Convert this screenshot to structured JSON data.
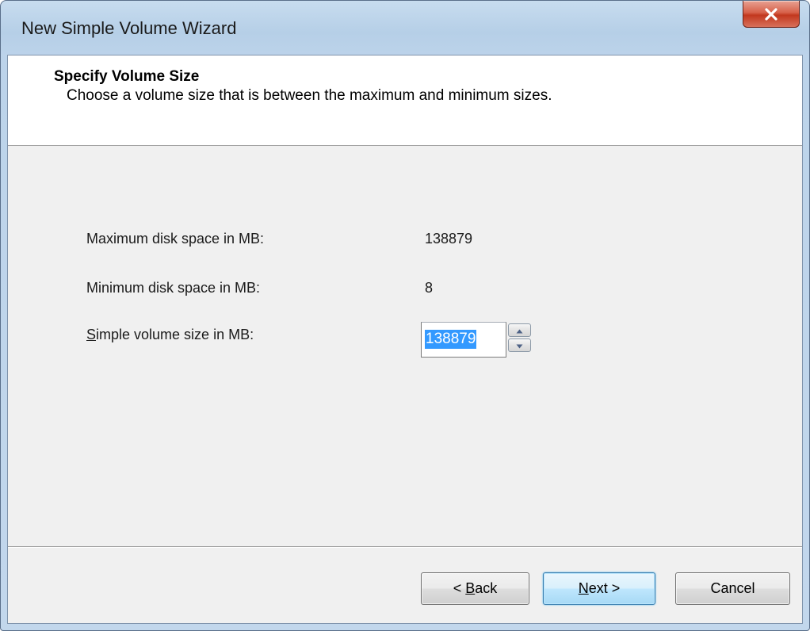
{
  "window": {
    "title": "New Simple Volume Wizard",
    "close_icon": "close-icon"
  },
  "header": {
    "title": "Specify Volume Size",
    "subtitle": "Choose a volume size that is between the maximum and minimum sizes."
  },
  "fields": {
    "max": {
      "label": "Maximum disk space in MB:",
      "value": "138879"
    },
    "min": {
      "label": "Minimum disk space in MB:",
      "value": "8"
    },
    "size": {
      "label_mnemonic": "S",
      "label_rest": "imple volume size in MB:",
      "value": "138879"
    }
  },
  "buttons": {
    "back": {
      "prefix": "< ",
      "mnemonic": "B",
      "rest": "ack"
    },
    "next": {
      "mnemonic": "N",
      "rest": "ext >"
    },
    "cancel": {
      "label": "Cancel"
    }
  },
  "colors": {
    "selection": "#3399ff",
    "close_button": "#c2381e",
    "default_button_border": "#3c7fb1"
  }
}
